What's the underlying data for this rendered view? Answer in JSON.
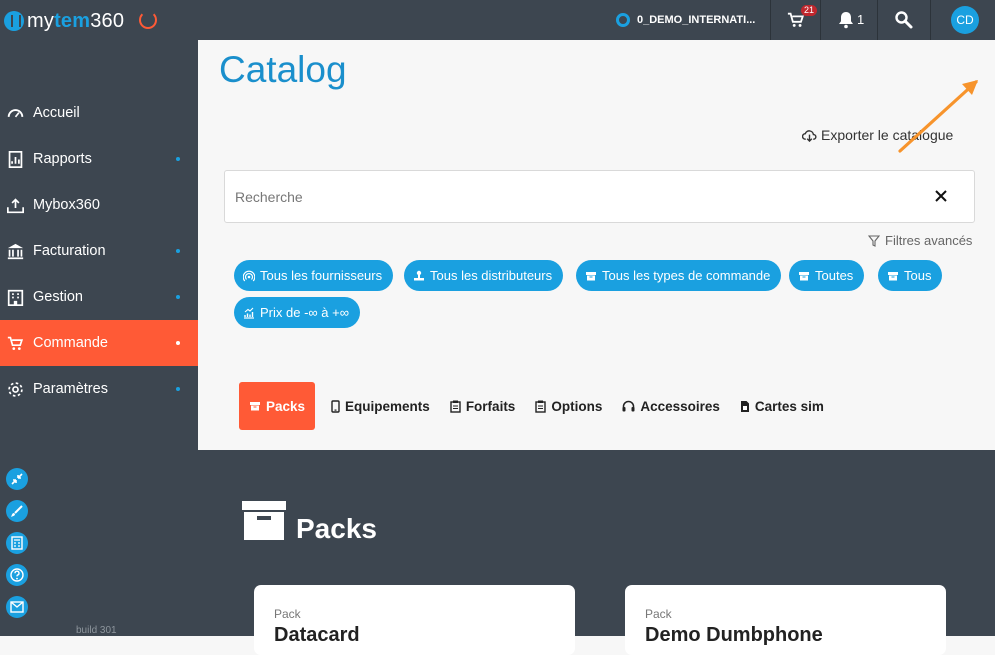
{
  "topbar": {
    "logo": {
      "my": "my",
      "tem": "tem",
      "num": "360"
    },
    "tenant": "0_DEMO_INTERNATI...",
    "cart_count": "21",
    "notification_count": "1",
    "avatar_initials": "CD"
  },
  "sidebar": {
    "items": [
      {
        "label": "Accueil",
        "icon": "dashboard-icon",
        "has_dot": false,
        "active": false
      },
      {
        "label": "Rapports",
        "icon": "report-icon",
        "has_dot": true,
        "active": false
      },
      {
        "label": "Mybox360",
        "icon": "inbox-upload-icon",
        "has_dot": false,
        "active": false
      },
      {
        "label": "Facturation",
        "icon": "bank-icon",
        "has_dot": true,
        "active": false
      },
      {
        "label": "Gestion",
        "icon": "building-icon",
        "has_dot": true,
        "active": false
      },
      {
        "label": "Commande",
        "icon": "cart-icon",
        "has_dot": true,
        "active": true
      },
      {
        "label": "Paramètres",
        "icon": "gear-icon",
        "has_dot": true,
        "active": false
      }
    ],
    "tools": [
      "collapse-icon",
      "brush-icon",
      "calculator-icon",
      "help-icon",
      "mail-icon"
    ],
    "build": "build 301"
  },
  "main": {
    "title": "Catalog",
    "export_label": "Exporter le catalogue",
    "search_placeholder": "Recherche",
    "advanced_filters": "Filtres avancés",
    "chips": [
      "Tous les fournisseurs",
      "Tous les distributeurs",
      "Tous les types de commande",
      "Toutes",
      "Tous",
      "Prix de -∞ à +∞"
    ],
    "tabs": [
      {
        "label": "Packs",
        "active": true
      },
      {
        "label": "Equipements",
        "active": false
      },
      {
        "label": "Forfaits",
        "active": false
      },
      {
        "label": "Options",
        "active": false
      },
      {
        "label": "Accessoires",
        "active": false
      },
      {
        "label": "Cartes sim",
        "active": false
      }
    ]
  },
  "section": {
    "title": "Packs",
    "cards": [
      {
        "kicker": "Pack",
        "title": "Datacard"
      },
      {
        "kicker": "Pack",
        "title": "Demo Dumbphone"
      }
    ]
  },
  "colors": {
    "sidebar_bg": "#3d4650",
    "accent_blue": "#1aa0e0",
    "accent_orange": "#ff5a36",
    "annotation_arrow": "#f7942c"
  }
}
